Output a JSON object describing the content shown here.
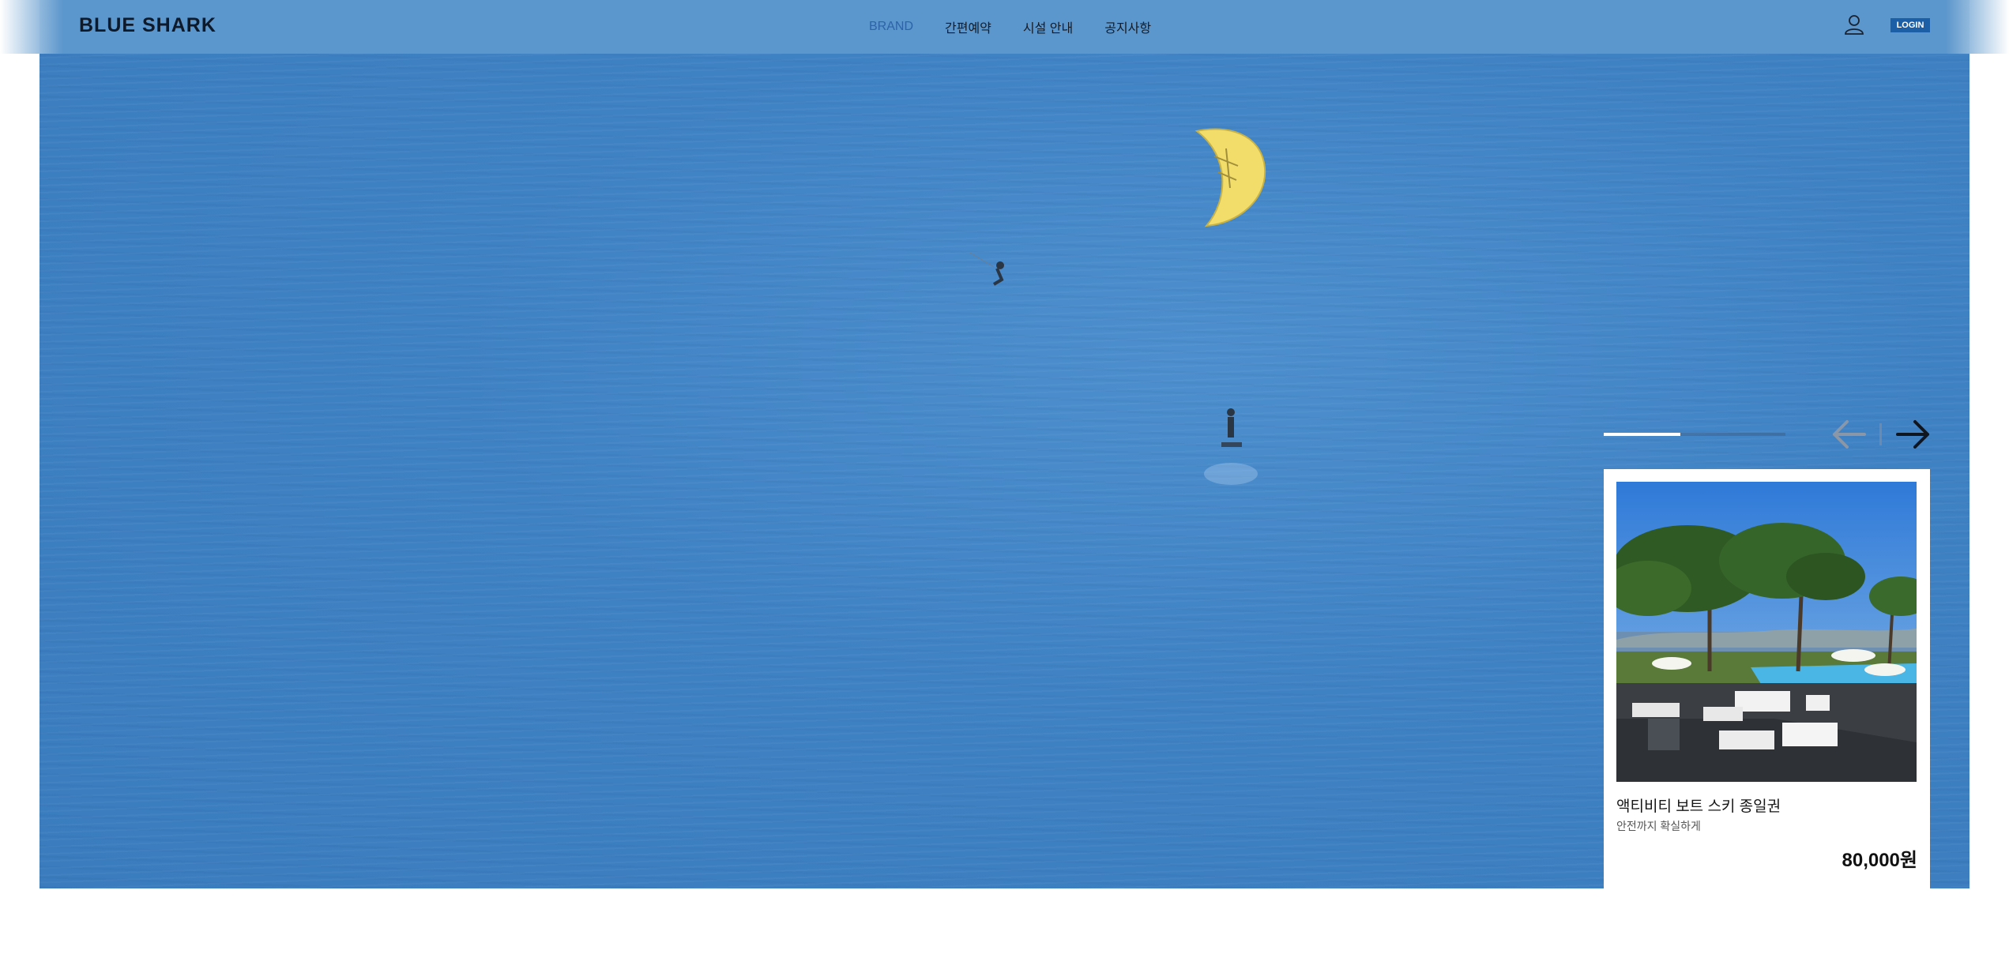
{
  "header": {
    "logo": "BLUE SHARK",
    "nav": [
      {
        "label": "BRAND",
        "active": true
      },
      {
        "label": "간편예약",
        "active": false
      },
      {
        "label": "시설 안내",
        "active": false
      },
      {
        "label": "공지사항",
        "active": false
      }
    ],
    "user_icon": "user-icon",
    "login_label": "LOGIN"
  },
  "colors": {
    "header_bg": "#5b96cc",
    "accent": "#1d5fa6",
    "nav_active": "#2d64a8"
  },
  "slider": {
    "progress": 0.42,
    "prev_icon": "arrow-left-icon",
    "next_icon": "arrow-right-icon"
  },
  "card": {
    "title": "액티비티 보트 스키 종일권",
    "subtitle": "안전까지 확실하게",
    "price": "80,000원"
  }
}
